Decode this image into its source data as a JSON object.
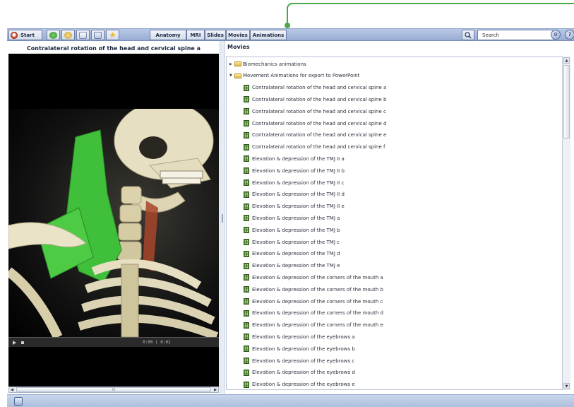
{
  "toolbar": {
    "start_label": "Start",
    "icons": [
      "home-icon",
      "favorites-icon",
      "document-icon",
      "window-icon",
      "star-icon"
    ],
    "tabs": [
      "Anatomy",
      "MRI",
      "Slides",
      "Movies",
      "Animations"
    ],
    "search_placeholder": "Search"
  },
  "player": {
    "title": "Contralateral rotation of the head and cervical spine a",
    "time": "0:00 | 0:02",
    "scroll_label": "III"
  },
  "movies": {
    "heading": "Movies",
    "folders": [
      {
        "label": "Biomechanics animations",
        "expanded": false
      },
      {
        "label": "Movement Animations for export to PowerPoint",
        "expanded": true
      }
    ],
    "items": [
      "Contralateral rotation of the head and cervical spine a",
      "Contralateral rotation of the head and cervical spine b",
      "Contralateral rotation of the head and cervical spine c",
      "Contralateral rotation of the head and cervical spine d",
      "Contralateral rotation of the head and cervical spine e",
      "Contralateral rotation of the head and cervical spine f",
      "Elevation & depression of the TMJ II a",
      "Elevation & depression of the TMJ II b",
      "Elevation & depression of the TMJ II c",
      "Elevation & depression of the TMJ II d",
      "Elevation & depression of the TMJ II e",
      "Elevation & depression of the TMJ a",
      "Elevation & depression of the TMJ b",
      "Elevation & depression of the TMJ c",
      "Elevation & depression of the TMJ d",
      "Elevation & depression of the TMJ e",
      "Elevation & depression of the corners of the mouth a",
      "Elevation & depression of the corners of the mouth b",
      "Elevation & depression of the corners of the mouth c",
      "Elevation & depression of the corners of the mouth d",
      "Elevation & depression of the corners of the mouth e",
      "Elevation & depression of the eyebrows a",
      "Elevation & depression of the eyebrows b",
      "Elevation & depression of the eyebrows c",
      "Elevation & depression of the eyebrows d",
      "Elevation & depression of the eyebrows e"
    ]
  },
  "colors": {
    "accent": "#4aa84a",
    "muscle_green": "#3fbf3a",
    "bone": "#e9e3c8"
  }
}
